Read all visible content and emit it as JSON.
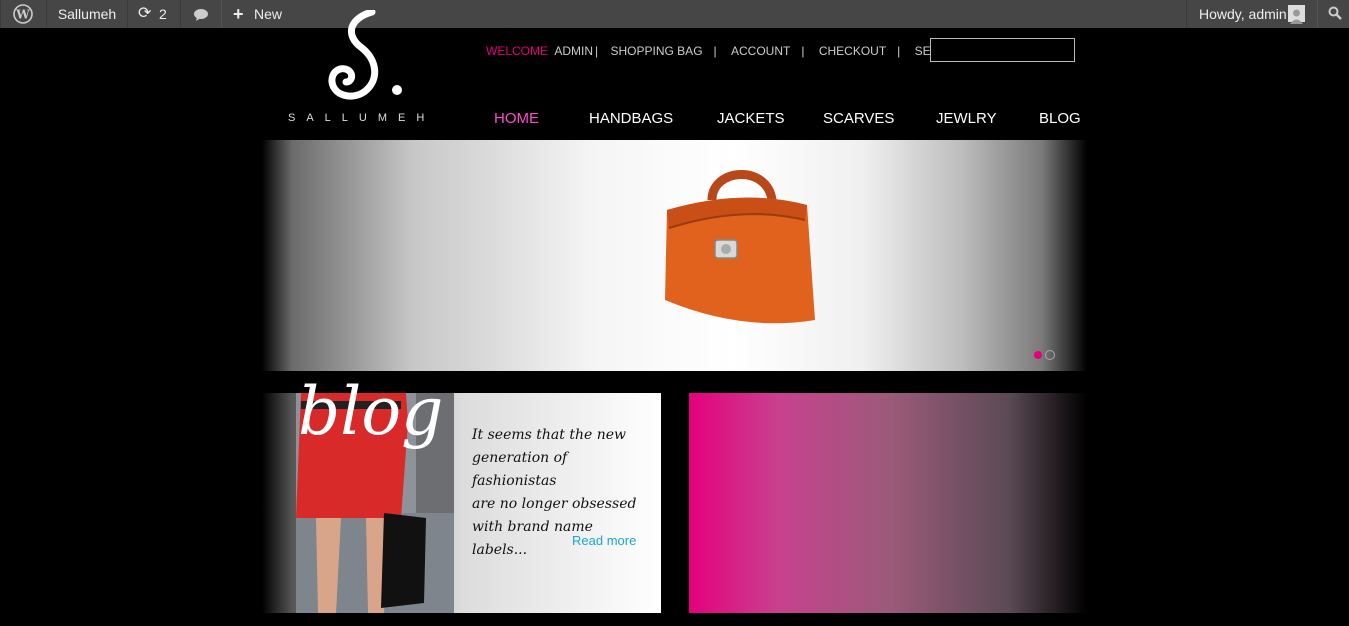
{
  "admin_bar": {
    "site_name": "Sallumeh",
    "updates_count": "2",
    "new_label": "New",
    "howdy": "Howdy, admin"
  },
  "header": {
    "logo_text": "SALLUMEH",
    "welcome": "WELCOME",
    "user": "ADMIN",
    "links": [
      "SHOPPING BAG",
      "ACCOUNT",
      "CHECKOUT",
      "SEARCH"
    ],
    "search_value": ""
  },
  "nav": [
    "HOME",
    "HANDBAGS",
    "JACKETS",
    "SCARVES",
    "JEWLRY",
    "BLOG"
  ],
  "slider": {
    "slides": 2,
    "active": 1
  },
  "blog": {
    "title": "blog",
    "quote_lines": [
      "It seems that the new",
      "generation of fashionistas",
      "are no longer obsessed",
      "with brand name labels..."
    ],
    "read_more": "Read more"
  },
  "colors": {
    "accent": "#e6007e",
    "link": "#1aa6d9",
    "admin_bar": "#464646"
  }
}
